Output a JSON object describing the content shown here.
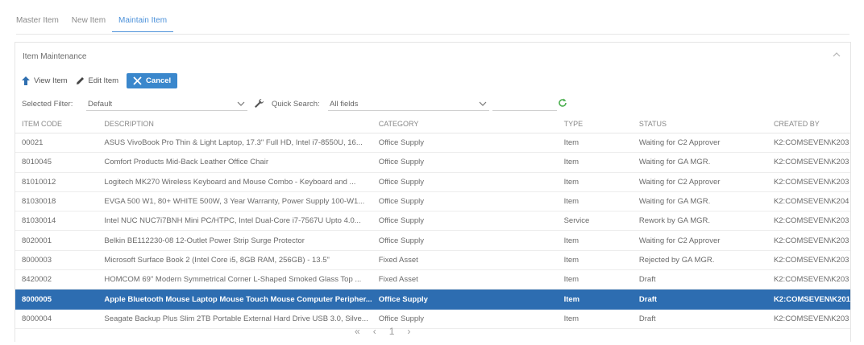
{
  "tabs": [
    "Master Item",
    "New Item",
    "Maintain Item"
  ],
  "panel": {
    "title": "Item Maintenance"
  },
  "toolbar": {
    "view": "View Item",
    "edit": "Edit Item",
    "cancel": "Cancel"
  },
  "filters": {
    "selected_label": "Selected Filter:",
    "selected_value": "Default",
    "quick_label": "Quick Search:",
    "quick_value": "All fields"
  },
  "table": {
    "headers": [
      "ITEM CODE",
      "DESCRIPTION",
      "CATEGORY",
      "TYPE",
      "STATUS",
      "CREATED BY"
    ],
    "rows": [
      [
        "00021",
        "ASUS VivoBook Pro Thin & Light Laptop, 17.3\" Full HD, Intel i7-8550U, 16...",
        "Office Supply",
        "Item",
        "Waiting for C2 Approver",
        "K2:COMSEVEN\\K203"
      ],
      [
        "8010045",
        "Comfort Products Mid-Back Leather Office Chair",
        "Office Supply",
        "Item",
        "Waiting for GA MGR.",
        "K2:COMSEVEN\\K203"
      ],
      [
        "81010012",
        "Logitech MK270 Wireless Keyboard and Mouse Combo - Keyboard and ...",
        "Office Supply",
        "Item",
        "Waiting for C2 Approver",
        "K2:COMSEVEN\\K203"
      ],
      [
        "81030018",
        "EVGA 500 W1, 80+ WHITE 500W, 3 Year Warranty, Power Supply 100-W1...",
        "Office Supply",
        "Item",
        "Waiting for GA MGR.",
        "K2:COMSEVEN\\K204"
      ],
      [
        "81030014",
        "Intel NUC NUC7i7BNH Mini PC/HTPC, Intel Dual-Core i7-7567U Upto 4.0...",
        "Office Supply",
        "Service",
        "Rework by GA MGR.",
        "K2:COMSEVEN\\K203"
      ],
      [
        "8020001",
        "Belkin BE112230-08 12-Outlet Power Strip Surge Protector",
        "Office Supply",
        "Item",
        "Waiting for C2 Approver",
        "K2:COMSEVEN\\K203"
      ],
      [
        "8000003",
        "Microsoft Surface Book 2 (Intel Core i5, 8GB RAM, 256GB) - 13.5\"",
        "Fixed Asset",
        "Item",
        "Rejected by GA MGR.",
        "K2:COMSEVEN\\K203"
      ],
      [
        "8420002",
        "HOMCOM 69\" Modern Symmetrical Corner L-Shaped Smoked Glass Top ...",
        "Fixed Asset",
        "Item",
        "Draft",
        "K2:COMSEVEN\\K203"
      ],
      [
        "8000005",
        "Apple Bluetooth Mouse Laptop Mouse Touch Mouse Computer Peripher...",
        "Office Supply",
        "Item",
        "Draft",
        "K2:COMSEVEN\\K201"
      ],
      [
        "8000004",
        "Seagate Backup Plus Slim 2TB Portable External Hard Drive USB 3.0, Silve...",
        "Office Supply",
        "Item",
        "Draft",
        "K2:COMSEVEN\\K203"
      ]
    ],
    "selected_row": 8
  },
  "pager": {
    "first": "«",
    "prev": "‹",
    "page": "1",
    "next": "›"
  },
  "colors": {
    "accent": "#3a87cc",
    "selected_row": "#2d6db1",
    "refresh": "#4caf50"
  }
}
